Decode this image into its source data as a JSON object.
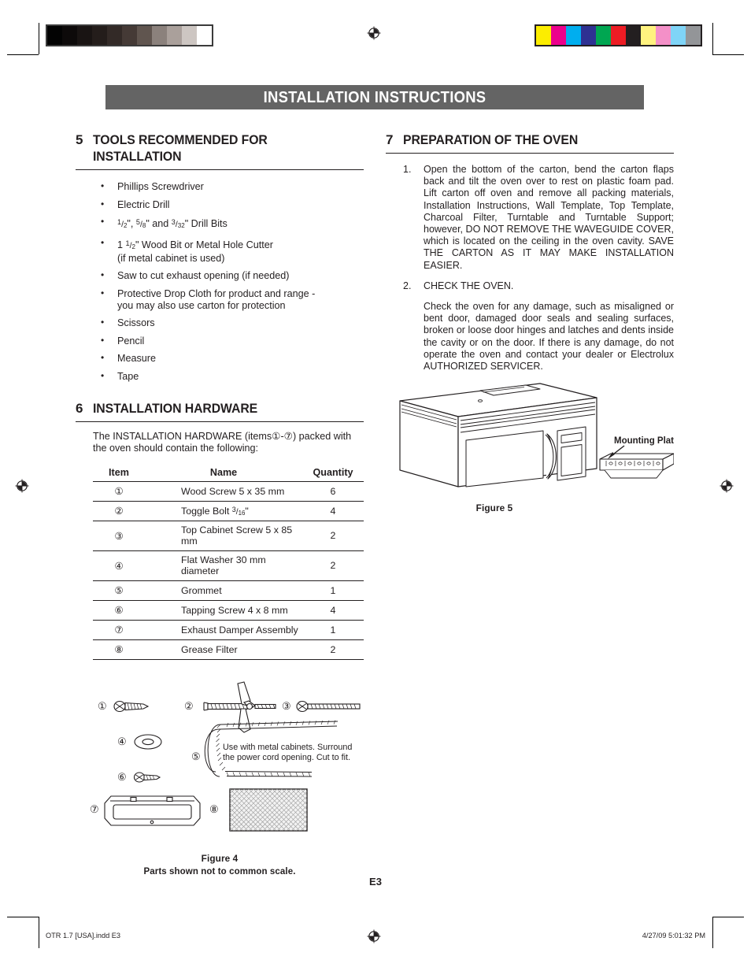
{
  "header": {
    "title": "INSTALLATION INSTRUCTIONS",
    "bar_color": "#646464",
    "text_color": "#ffffff"
  },
  "print_marks": {
    "gray_wedge": [
      "#030303",
      "#0d0a0a",
      "#191413",
      "#241d1b",
      "#332a27",
      "#453a36",
      "#60554f",
      "#8b817c",
      "#aaa09b",
      "#cdc6c2",
      "#ffffff"
    ],
    "color_bar": [
      "#fced00",
      "#ec008c",
      "#00aeef",
      "#2e3192",
      "#00a651",
      "#ed1c24",
      "#231f20",
      "#fff27f",
      "#f490c8",
      "#7fd4f7",
      "#939598"
    ]
  },
  "sections": {
    "tools": {
      "number": "5",
      "title": "TOOLS RECOMMENDED FOR INSTALLATION",
      "items": [
        {
          "text": "Phillips Screwdriver"
        },
        {
          "text": "Electric Drill"
        },
        {
          "html": "<span class=\"frac\"><sup>1</sup>/<sub>2</sub></span>\", <span class=\"frac\"><sup>5</sup>/<sub>8</sub></span>\" and <span class=\"frac\"><sup>3</sup>/<sub>32</sub></span>\" Drill Bits"
        },
        {
          "html": "1 <span class=\"frac\"><sup>1</sup>/<sub>2</sub></span>\" Wood Bit or Metal Hole Cutter<br>(if metal cabinet is used)"
        },
        {
          "text": "Saw to cut exhaust opening (if needed)"
        },
        {
          "html": "Protective Drop Cloth for product and range -<br>you may also use carton for protection"
        },
        {
          "text": "Scissors"
        },
        {
          "text": "Pencil"
        },
        {
          "text": "Measure"
        },
        {
          "text": "Tape"
        }
      ]
    },
    "hardware": {
      "number": "6",
      "title": "INSTALLATION HARDWARE",
      "intro_html": "The INSTALLATION HARDWARE (items①-⑦) packed with the oven should contain the following:",
      "table": {
        "columns": [
          "Item",
          "Name",
          "Quantity"
        ],
        "rows": [
          {
            "item": "①",
            "name": "Wood Screw 5 x 35 mm",
            "qty": "6"
          },
          {
            "item": "②",
            "name_html": "Toggle Bolt <span class=\"frac\"><sup>3</sup>/<sub>16</sub></span>\"",
            "qty": "4"
          },
          {
            "item": "③",
            "name": "Top Cabinet Screw 5 x 85 mm",
            "qty": "2"
          },
          {
            "item": "④",
            "name": "Flat Washer 30 mm diameter",
            "qty": "2"
          },
          {
            "item": "⑤",
            "name": "Grommet",
            "qty": "1"
          },
          {
            "item": "⑥",
            "name": "Tapping Screw 4 x 8 mm",
            "qty": "4"
          },
          {
            "item": "⑦",
            "name": "Exhaust Damper Assembly",
            "qty": "1"
          },
          {
            "item": "⑧",
            "name": "Grease Filter",
            "qty": "2"
          }
        ]
      },
      "figure": {
        "caption": "Figure 4",
        "subcaption": "Parts shown not to common scale.",
        "callouts": [
          "①",
          "②",
          "③",
          "④",
          "⑤",
          "⑥",
          "⑦",
          "⑧"
        ],
        "grommet_note_line1": "Use with metal cabinets. Surround",
        "grommet_note_line2": "the power cord opening. Cut to fit."
      }
    },
    "preparation": {
      "number": "7",
      "title": "PREPARATION OF THE OVEN",
      "steps": [
        {
          "index": "1.",
          "paragraphs": [
            "Open the bottom of the carton, bend the carton flaps back and tilt the oven over to rest on plastic foam pad. Lift carton off oven and remove all packing materials, Installation Instructions, Wall Template, Top Template, Charcoal Filter, Turntable and Turntable Support; however, DO NOT REMOVE THE WAVEGUIDE COVER, which is located on the ceiling in the oven cavity. SAVE THE CARTON AS IT MAY MAKE INSTALLATION EASIER."
          ]
        },
        {
          "index": "2.",
          "paragraphs": [
            "CHECK THE OVEN.",
            "Check the oven for any damage, such as misaligned or bent door, damaged door seals and sealing surfaces, broken or loose door hinges and latches and dents inside the cavity or on the door. If there is any damage, do not operate the oven and contact your dealer or Electrolux AUTHORIZED SERVICER."
          ]
        }
      ],
      "figure": {
        "caption": "Figure 5",
        "label_mounting_plate": "Mounting Plate"
      }
    }
  },
  "page_number": "E3",
  "footer": {
    "left": "OTR 1.7 [USA].indd   E3",
    "right": "4/27/09   5:01:32 PM"
  }
}
